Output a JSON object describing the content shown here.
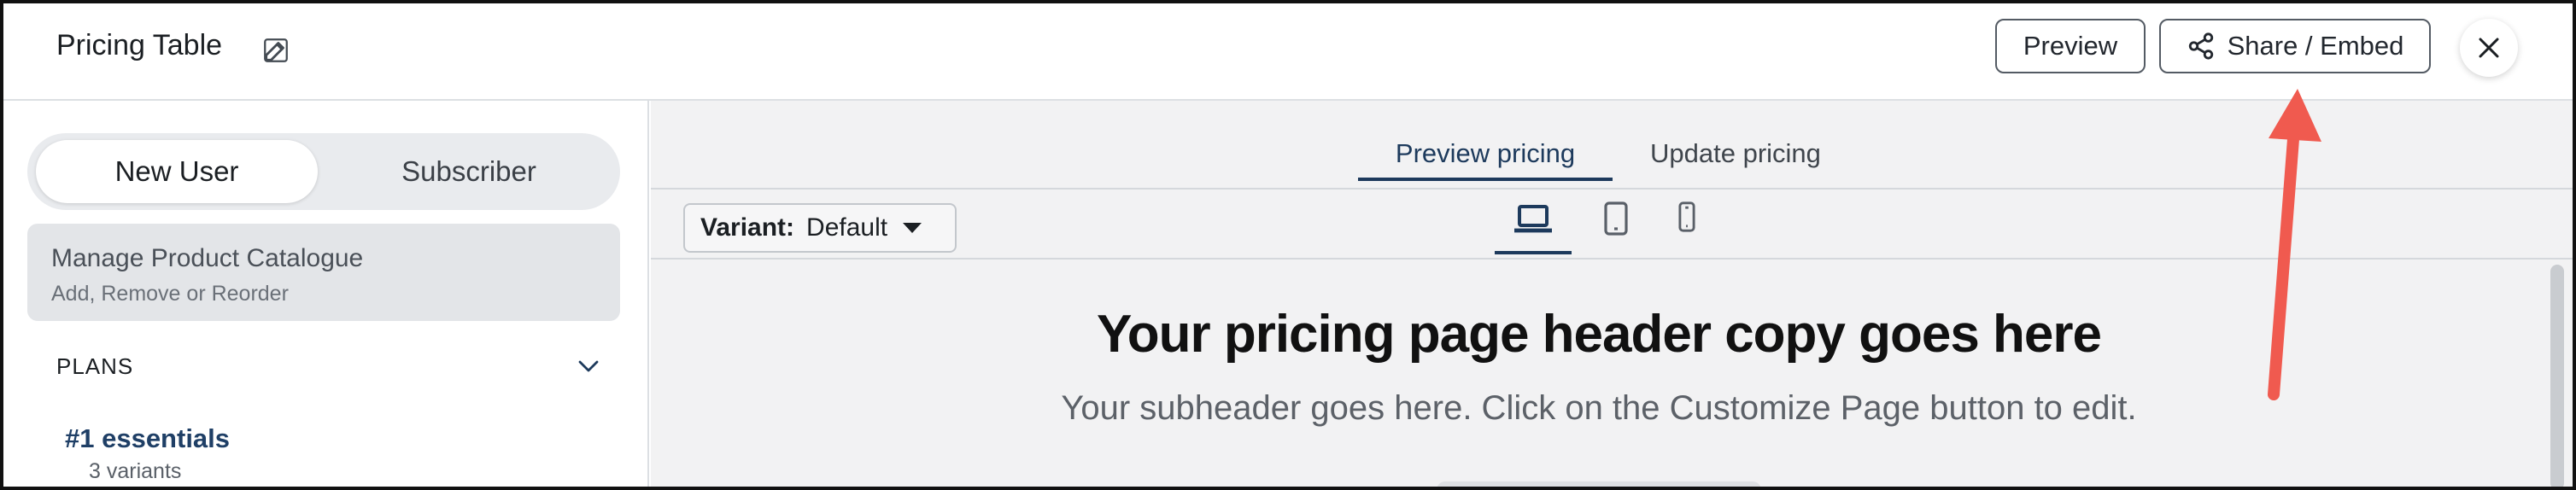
{
  "header": {
    "title": "Pricing Table",
    "edit_icon": "pencil-icon",
    "preview_label": "Preview",
    "share_label": "Share / Embed",
    "share_icon": "share-icon",
    "close_icon": "close-icon"
  },
  "sidebar": {
    "segment": {
      "active": "New User",
      "inactive": "Subscriber"
    },
    "catalogue": {
      "title": "Manage Product Catalogue",
      "subtitle": "Add, Remove or Reorder"
    },
    "plans_label": "PLANS",
    "plans_chevron": "chevron-down-icon",
    "plans": [
      {
        "name": "#1 essentials",
        "variants": "3 variants"
      }
    ]
  },
  "main": {
    "tabs": [
      {
        "label": "Preview pricing",
        "active": true
      },
      {
        "label": "Update pricing",
        "active": false
      }
    ],
    "variant": {
      "label": "Variant:",
      "value": "Default"
    },
    "devices": [
      {
        "icon": "laptop-icon",
        "active": true
      },
      {
        "icon": "tablet-icon",
        "active": false
      },
      {
        "icon": "phone-icon",
        "active": false
      }
    ],
    "hero": {
      "title": "Your pricing page header copy goes here",
      "subtitle": "Your subheader goes here. Click on the Customize Page button to edit."
    }
  },
  "colors": {
    "accent": "#1d3a5c",
    "annotation_arrow": "#f05a4f",
    "preview_bg": "#f2f2f3"
  }
}
